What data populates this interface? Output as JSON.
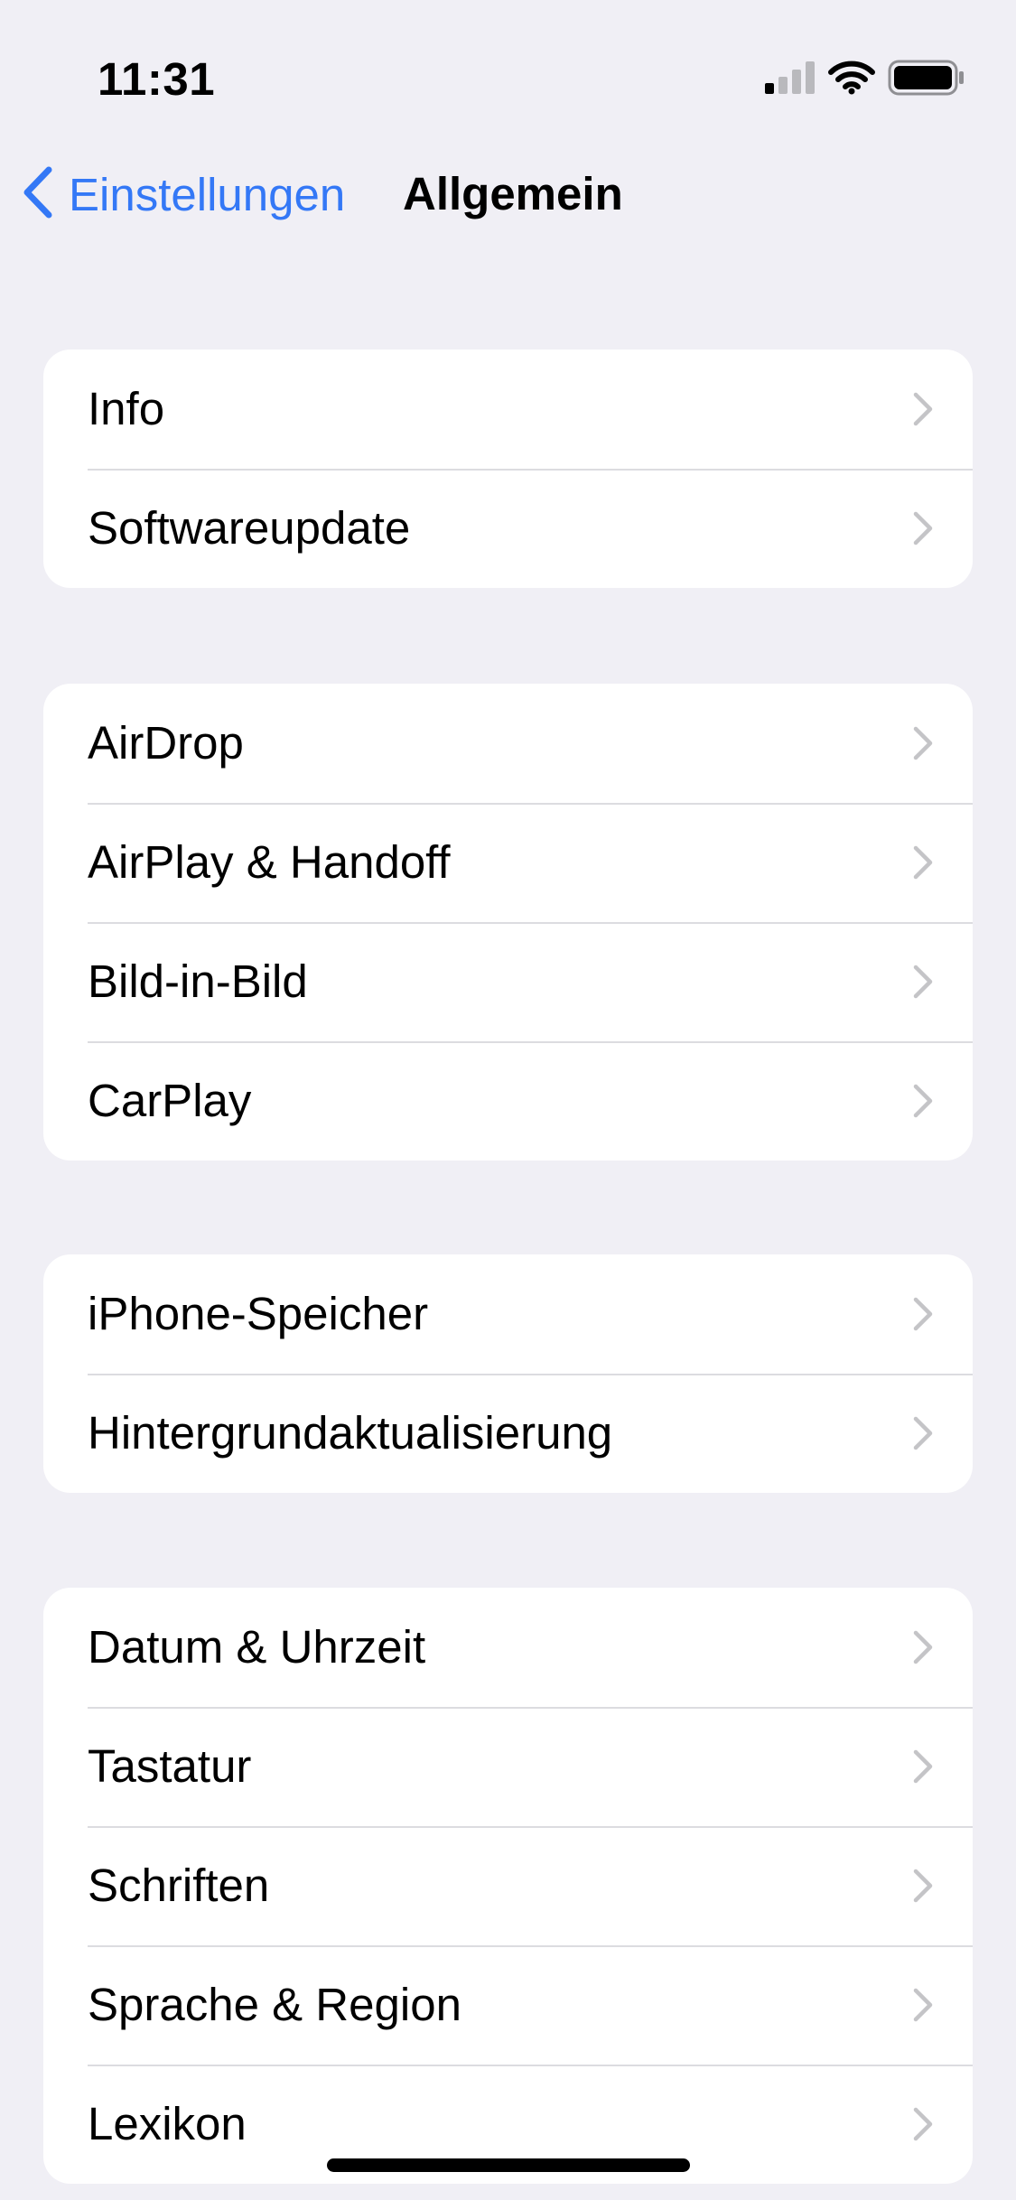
{
  "status_bar": {
    "time": "11:31",
    "signal_icon": "cellular-signal-icon",
    "wifi_icon": "wifi-icon",
    "battery_icon": "battery-icon"
  },
  "nav": {
    "back_label": "Einstellungen",
    "back_icon": "chevron-left-icon",
    "title": "Allgemein"
  },
  "colors": {
    "accent": "#3478f6",
    "background": "#f0eff5",
    "cell": "#ffffff",
    "separator": "#dcdce0",
    "chevron": "#c4c4c7"
  },
  "groups": [
    {
      "items": [
        {
          "label": "Info"
        },
        {
          "label": "Softwareupdate"
        }
      ]
    },
    {
      "items": [
        {
          "label": "AirDrop"
        },
        {
          "label": "AirPlay & Handoff"
        },
        {
          "label": "Bild-in-Bild"
        },
        {
          "label": "CarPlay"
        }
      ]
    },
    {
      "items": [
        {
          "label": "iPhone-Speicher"
        },
        {
          "label": "Hintergrundaktualisierung"
        }
      ]
    },
    {
      "items": [
        {
          "label": "Datum & Uhrzeit"
        },
        {
          "label": "Tastatur"
        },
        {
          "label": "Schriften"
        },
        {
          "label": "Sprache & Region"
        },
        {
          "label": "Lexikon"
        }
      ]
    }
  ]
}
